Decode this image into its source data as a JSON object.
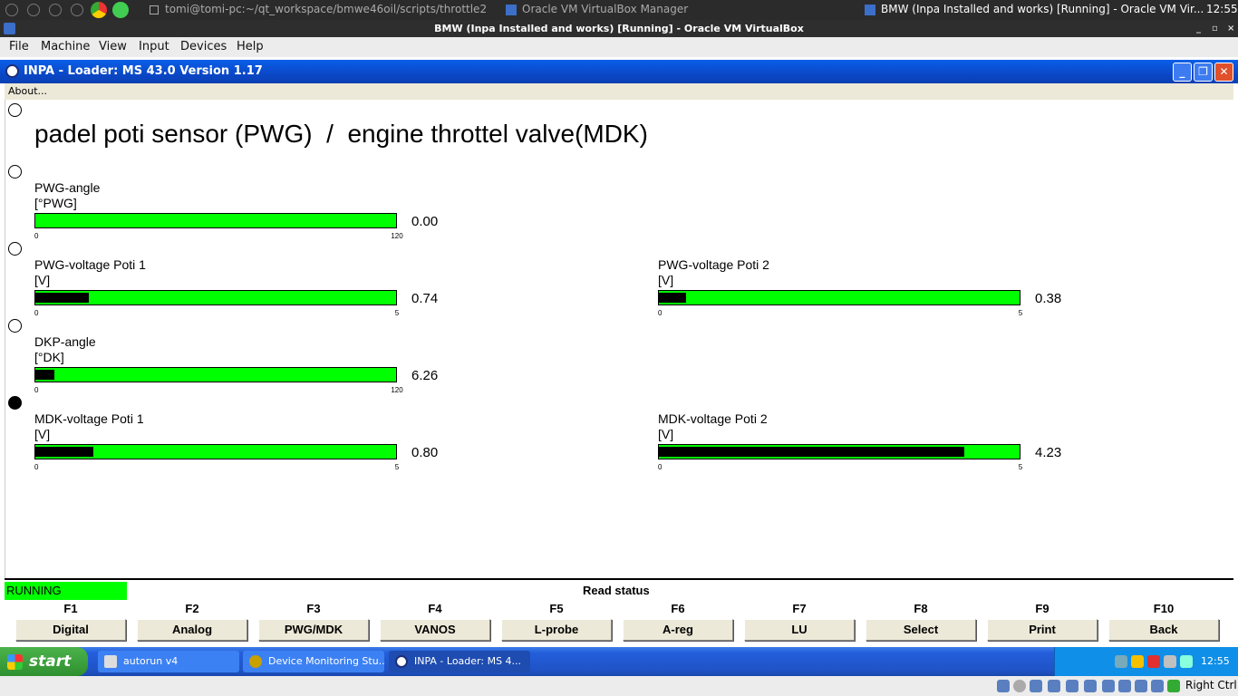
{
  "host_panel": {
    "terminal": "tomi@tomi-pc:~/qt_workspace/bmwe46oil/scripts/throttle2",
    "vbox_manager": "Oracle VM VirtualBox Manager",
    "vm_task": "BMW (Inpa Installed and works) [Running] - Oracle VM Vir...",
    "clock": "12:55"
  },
  "vbox_window": {
    "title": "BMW (Inpa Installed and works) [Running] - Oracle VM VirtualBox",
    "menu": [
      "File",
      "Machine",
      "View",
      "Input",
      "Devices",
      "Help"
    ],
    "right_ctrl": "Right Ctrl"
  },
  "inpa": {
    "title": "INPA - Loader:  MS 43.0 Version 1.17",
    "menu_about": "About...",
    "heading": "padel poti sensor (PWG)  /  engine throttel valve(MDK)",
    "gauges": [
      {
        "id": "pwg-angle",
        "label": "PWG-angle",
        "unit": "[°PWG]",
        "min": "0",
        "max": "120",
        "value": "0.00",
        "fraction": 0.0
      },
      {
        "id": "pwg-voltage-1",
        "label": "PWG-voltage Poti 1",
        "unit": "[V]",
        "min": "0",
        "max": "5",
        "value": "0.74",
        "fraction": 0.148
      },
      {
        "id": "pwg-voltage-2",
        "label": "PWG-voltage Poti 2",
        "unit": "[V]",
        "min": "0",
        "max": "5",
        "value": "0.38",
        "fraction": 0.076
      },
      {
        "id": "dkp-angle",
        "label": "DKP-angle",
        "unit": "[°DK]",
        "min": "0",
        "max": "120",
        "value": "6.26",
        "fraction": 0.052
      },
      {
        "id": "mdk-voltage-1",
        "label": "MDK-voltage Poti 1",
        "unit": "[V]",
        "min": "0",
        "max": "5",
        "value": "0.80",
        "fraction": 0.16
      },
      {
        "id": "mdk-voltage-2",
        "label": "MDK-voltage Poti 2",
        "unit": "[V]",
        "min": "0",
        "max": "5",
        "value": "4.23",
        "fraction": 0.846
      }
    ],
    "status": "RUNNING",
    "read_status": "Read status",
    "fkeys": [
      {
        "key": "F1",
        "label": "Digital"
      },
      {
        "key": "F2",
        "label": "Analog"
      },
      {
        "key": "F3",
        "label": "PWG/MDK"
      },
      {
        "key": "F4",
        "label": "VANOS"
      },
      {
        "key": "F5",
        "label": "L-probe"
      },
      {
        "key": "F6",
        "label": "A-reg"
      },
      {
        "key": "F7",
        "label": "LU"
      },
      {
        "key": "F8",
        "label": "Select"
      },
      {
        "key": "F9",
        "label": "Print"
      },
      {
        "key": "F10",
        "label": "Back"
      }
    ]
  },
  "taskbar": {
    "start": "start",
    "tasks": [
      "autorun v4",
      "Device Monitoring Stu...",
      "INPA - Loader:  MS 4..."
    ],
    "help": "?",
    "clock": "12:55"
  }
}
